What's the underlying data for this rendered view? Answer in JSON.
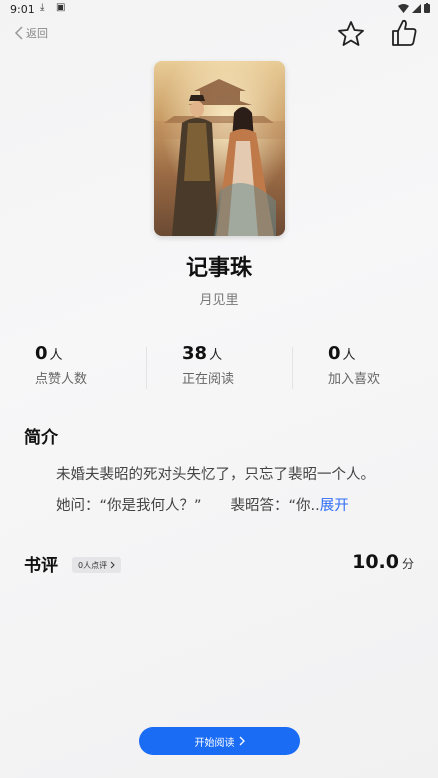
{
  "status_bar": {
    "time": "9:01"
  },
  "nav": {
    "back_label": "返回"
  },
  "book": {
    "title": "记事珠",
    "author": "月见里"
  },
  "stats": [
    {
      "value": "0",
      "unit": "人",
      "label": "点赞人数"
    },
    {
      "value": "38",
      "unit": "人",
      "label": "正在阅读"
    },
    {
      "value": "0",
      "unit": "人",
      "label": "加入喜欢"
    }
  ],
  "intro": {
    "heading": "简介",
    "line1": "未婚夫裴昭的死对头失忆了，只忘了裴昭一个人。",
    "line2": "她问：“你是我何人？”　　裴昭答：“你..",
    "expand_label": "展开"
  },
  "review": {
    "heading": "书评",
    "badge": "0人点评",
    "score": "10.0",
    "score_unit": "分"
  },
  "actions": {
    "start_reading": "开始阅读"
  },
  "colors": {
    "accent": "#1a6cf5",
    "link": "#2f6df6"
  }
}
